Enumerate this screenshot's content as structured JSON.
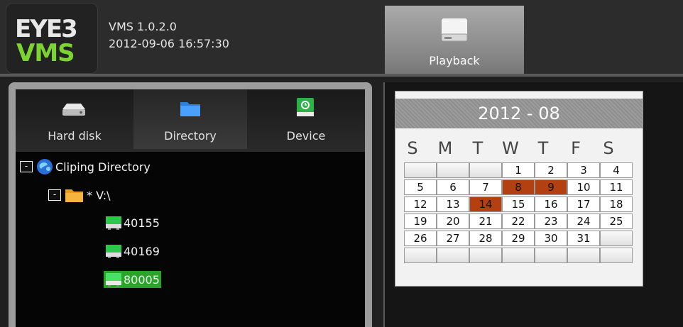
{
  "header": {
    "logo_top": "EYE3",
    "logo_bottom": "VMS",
    "version": "VMS 1.0.2.0",
    "datetime": "2012-09-06 16:57:30",
    "playback_label": "Playback"
  },
  "left_tabs": {
    "hard_disk": "Hard disk",
    "directory": "Directory",
    "device": "Device"
  },
  "tree": {
    "root_label": "Cliping Directory",
    "folder_label": "* V:\\",
    "items": [
      "40155",
      "40169",
      "80005"
    ],
    "selected": "80005",
    "toggle_symbol": "-"
  },
  "calendar": {
    "title": "2012 - 08",
    "weekdays": [
      "S",
      "M",
      "T",
      "W",
      "T",
      "F",
      "S"
    ],
    "rows": [
      [
        "",
        "",
        "",
        "1",
        "2",
        "3",
        "4"
      ],
      [
        "5",
        "6",
        "7",
        "8",
        "9",
        "10",
        "11"
      ],
      [
        "12",
        "13",
        "14",
        "15",
        "16",
        "17",
        "18"
      ],
      [
        "19",
        "20",
        "21",
        "22",
        "23",
        "24",
        "25"
      ],
      [
        "26",
        "27",
        "28",
        "29",
        "30",
        "31",
        ""
      ],
      [
        "",
        "",
        "",
        "",
        "",
        "",
        ""
      ]
    ],
    "highlighted_days": [
      "8",
      "9",
      "14"
    ],
    "highlight_color": "#b34010"
  }
}
